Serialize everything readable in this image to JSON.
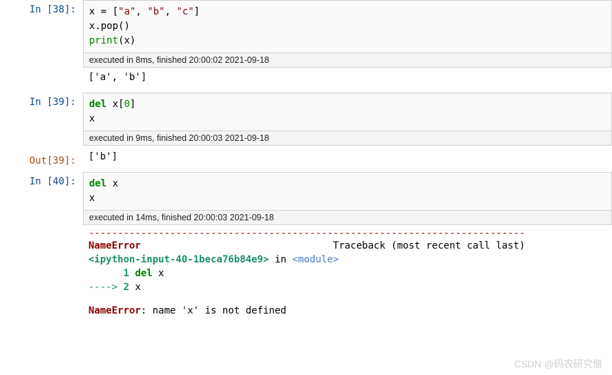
{
  "cells": [
    {
      "in_label": "In  [38]:",
      "code_lines": [
        [
          {
            "t": "x ",
            "c": ""
          },
          {
            "t": "=",
            "c": ""
          },
          {
            "t": " [",
            "c": ""
          },
          {
            "t": "\"a\"",
            "c": "c-str"
          },
          {
            "t": ", ",
            "c": ""
          },
          {
            "t": "\"b\"",
            "c": "c-str"
          },
          {
            "t": ", ",
            "c": ""
          },
          {
            "t": "\"c\"",
            "c": "c-str"
          },
          {
            "t": "]",
            "c": ""
          }
        ],
        [
          {
            "t": "x.pop()",
            "c": ""
          }
        ],
        [
          {
            "t": "print",
            "c": "c-builtin"
          },
          {
            "t": "(x)",
            "c": ""
          }
        ]
      ],
      "timing": "executed in 8ms, finished 20:00:02 2021-09-18",
      "plain_out": "['a', 'b']"
    },
    {
      "in_label": "In  [39]:",
      "code_lines": [
        [
          {
            "t": "del",
            "c": "c-keyword"
          },
          {
            "t": " x[",
            "c": ""
          },
          {
            "t": "0",
            "c": "c-builtin"
          },
          {
            "t": "]",
            "c": ""
          }
        ],
        [
          {
            "t": "x",
            "c": ""
          }
        ]
      ],
      "timing": "executed in 9ms, finished 20:00:03 2021-09-18",
      "out_label": "Out[39]:",
      "out_value": "['b']"
    },
    {
      "in_label": "In  [40]:",
      "code_lines": [
        [
          {
            "t": "del",
            "c": "c-keyword"
          },
          {
            "t": " x",
            "c": ""
          }
        ],
        [
          {
            "t": "x",
            "c": ""
          }
        ]
      ],
      "timing": "executed in 14ms, finished 20:00:03 2021-09-18",
      "traceback": {
        "dash": "---------------------------------------------------------------------------",
        "head_left": "NameError",
        "head_right": "Traceback (most recent call last)",
        "loc_link": "<ipython-input-40-1beca76b84e9>",
        "loc_in": " in ",
        "loc_mod": "<module>",
        "line1_num": "      1 ",
        "line1_kw": "del",
        "line1_rest": " x",
        "line2_arrow": "----> ",
        "line2_num": "2 ",
        "line2_rest": "x",
        "final_name": "NameError",
        "final_msg": ": name 'x' is not defined"
      }
    }
  ],
  "watermark": "CSDN @码农研究僧"
}
